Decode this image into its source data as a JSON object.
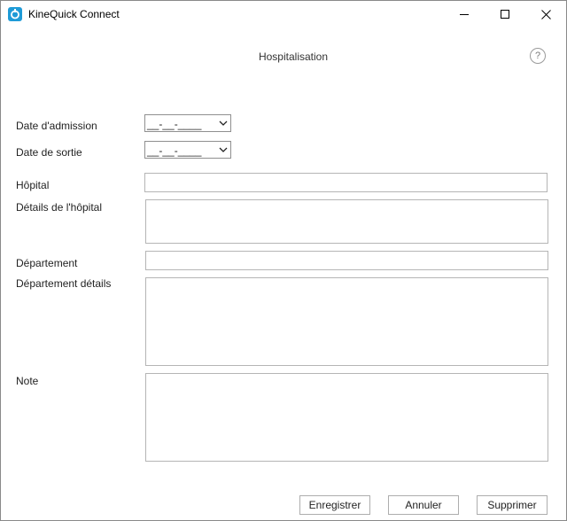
{
  "window": {
    "title": "KineQuick Connect"
  },
  "dialog": {
    "title": "Hospitalisation",
    "help_glyph": "?"
  },
  "form": {
    "admission_label": "Date d'admission",
    "admission_value": "__-__-____",
    "discharge_label": "Date de sortie",
    "discharge_value": "__-__-____",
    "hospital_label": "Hôpital",
    "hospital_value": "",
    "hospital_details_label": "Détails de l'hôpital",
    "hospital_details_value": "",
    "department_label": "Département",
    "department_value": "",
    "department_details_label": "Département détails",
    "department_details_value": "",
    "note_label": "Note",
    "note_value": ""
  },
  "buttons": {
    "save": "Enregistrer",
    "cancel": "Annuler",
    "delete": "Supprimer"
  },
  "colors": {
    "app_icon": "#1f9bd7",
    "border": "#b5b5b5"
  }
}
